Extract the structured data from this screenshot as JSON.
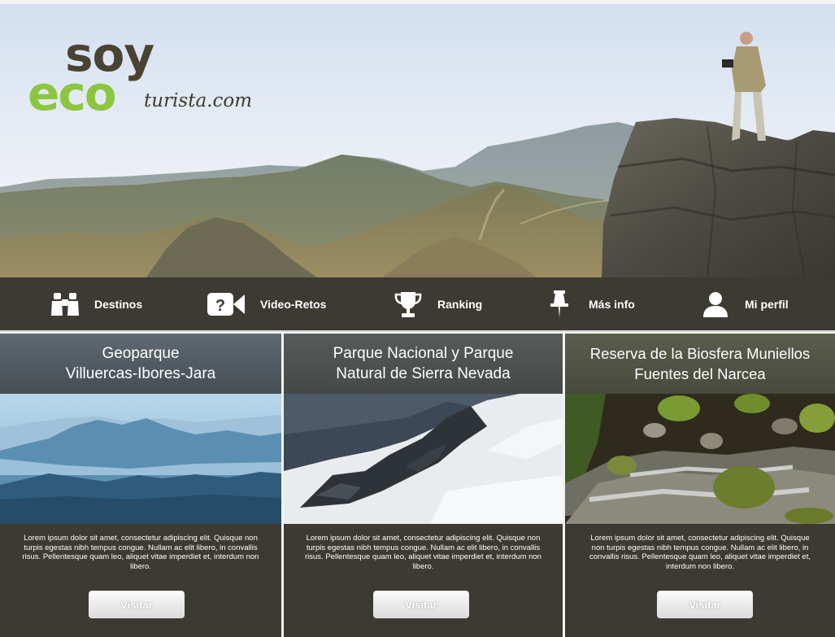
{
  "brand": {
    "logo_top": "soy",
    "logo_bottom": "eco",
    "logo_domain": "turista.com",
    "colors": {
      "green": "#8cc63f",
      "dark": "#4a4334"
    }
  },
  "nav": {
    "items": [
      {
        "label": "Destinos",
        "icon": "binoculars-icon"
      },
      {
        "label": "Video-Retos",
        "icon": "video-camera-icon"
      },
      {
        "label": "Ranking",
        "icon": "trophy-icon"
      },
      {
        "label": "Más info",
        "icon": "pushpin-icon"
      },
      {
        "label": "Mi perfil",
        "icon": "user-icon"
      }
    ],
    "bg_color": "#3c3a33"
  },
  "cards": [
    {
      "title": "Geoparque\nVilluercas-Ibores-Jara",
      "image": "misty-mountains-image",
      "description": "Lorem ipsum dolor sit amet, consectetur adipiscing elit. Quisque non turpis egestas nibh tempus congue. Nullam ac elit libero, in convallis risus. Pellentesque quam leo, aliquet vitae imperdiet et, interdum non libero.",
      "button": "Visitar"
    },
    {
      "title": "Parque Nacional y Parque\nNatural de Sierra Nevada",
      "image": "snowy-ridge-image",
      "description": "Lorem ipsum dolor sit amet, consectetur adipiscing elit. Quisque non turpis egestas nibh tempus congue. Nullam ac elit libero, in convallis risus. Pellentesque quam leo, aliquet vitae imperdiet et, interdum non libero.",
      "button": "Visitar"
    },
    {
      "title": "Reserva de la Biosfera Muniellos\nFuentes del Narcea",
      "image": "mossy-stream-image",
      "description": "Lorem ipsum dolor sit amet, consectetur adipiscing elit. Quisque non turpis egestas nibh tempus congue. Nullam ac elit libero, in convallis risus. Pellentesque quam leo, aliquet vitae imperdiet et, interdum non libero.",
      "button": "Visitar"
    }
  ]
}
